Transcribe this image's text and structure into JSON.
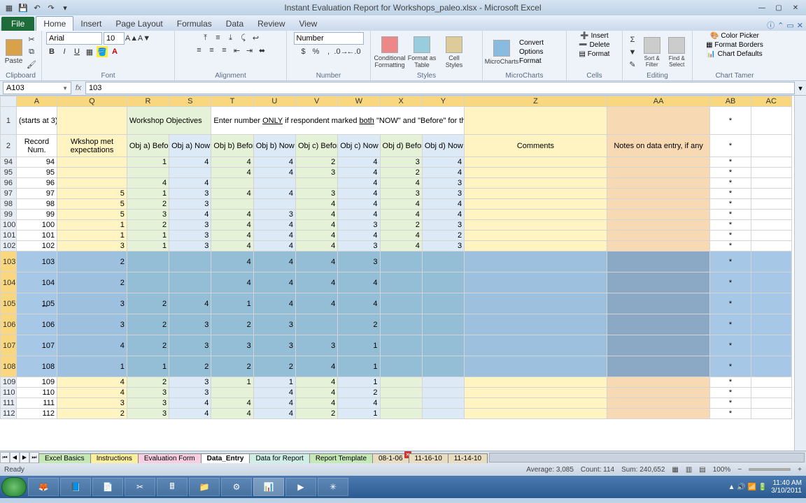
{
  "window": {
    "title": "Instant Evaluation Report for Workshops_paleo.xlsx - Microsoft Excel"
  },
  "ribbon": {
    "file": "File",
    "tabs": [
      "Home",
      "Insert",
      "Page Layout",
      "Formulas",
      "Data",
      "Review",
      "View"
    ],
    "active_tab": "Home",
    "groups": {
      "clipboard": "Clipboard",
      "font": "Font",
      "alignment": "Alignment",
      "number": "Number",
      "styles": "Styles",
      "microcharts": "MicroCharts",
      "cells": "Cells",
      "editing": "Editing",
      "charttamer": "Chart Tamer"
    },
    "clipboard_paste": "Paste",
    "font_name": "Arial",
    "font_size": "10",
    "number_format": "Number",
    "styles_items": {
      "cond": "Conditional Formatting",
      "table": "Format as Table",
      "cell": "Cell Styles"
    },
    "micro": {
      "a": "MicroCharts",
      "b": "Convert",
      "c": "Options",
      "d": "Format"
    },
    "cells": {
      "ins": "Insert",
      "del": "Delete",
      "fmt": "Format"
    },
    "editing": {
      "sort": "Sort & Filter",
      "find": "Find & Select"
    },
    "tamer": {
      "pick": "Color Picker",
      "borders": "Format Borders",
      "defaults": "Chart Defaults"
    }
  },
  "formula": {
    "name_box": "A103",
    "value": "103"
  },
  "columns": [
    "A",
    "Q",
    "R",
    "S",
    "T",
    "U",
    "V",
    "W",
    "X",
    "Y",
    "Z",
    "AA",
    "AB",
    "AC"
  ],
  "row1": {
    "a": "(starts at 3)",
    "r": "Workshop Objectives",
    "t": "Enter number ONLY if respondent marked both \"NOW\" and \"Before\" for that objective",
    "ab": "*"
  },
  "row2": {
    "a": "Record Num.",
    "q": "Wkshop met expectations",
    "r": "Obj a) Before",
    "s": "Obj a) Now",
    "t": "Obj b) Before",
    "u": "Obj b) Now",
    "v": "Obj c) Before",
    "w": "Obj c) Now",
    "x": "Obj d) Before",
    "y": "Obj d) Now",
    "z": "Comments",
    "aa": "Notes on data entry, if any",
    "ab": "*"
  },
  "rows": [
    {
      "n": 94,
      "a": 94,
      "q": "",
      "r": 1,
      "s": 4,
      "t": 4,
      "u": 4,
      "v": 2,
      "w": 4,
      "x": 3,
      "y": 4
    },
    {
      "n": 95,
      "a": 95,
      "q": "",
      "r": "",
      "s": "",
      "t": 4,
      "u": 4,
      "v": 3,
      "w": 4,
      "x": 2,
      "y": 4
    },
    {
      "n": 96,
      "a": 96,
      "q": "",
      "r": 4,
      "s": 4,
      "t": "",
      "u": "",
      "v": "",
      "w": 4,
      "x": 4,
      "y": 3
    },
    {
      "n": 97,
      "a": 97,
      "q": 5,
      "r": 1,
      "s": 3,
      "t": 4,
      "u": 4,
      "v": 3,
      "w": 4,
      "x": 3,
      "y": 3
    },
    {
      "n": 98,
      "a": 98,
      "q": 5,
      "r": 2,
      "s": 3,
      "t": "",
      "u": "",
      "v": 4,
      "w": 4,
      "x": 4,
      "y": 4
    },
    {
      "n": 99,
      "a": 99,
      "q": 5,
      "r": 3,
      "s": 4,
      "t": 4,
      "u": 3,
      "v": 4,
      "w": 4,
      "x": 4,
      "y": 4
    },
    {
      "n": 100,
      "a": 100,
      "q": 1,
      "r": 2,
      "s": 3,
      "t": 4,
      "u": 4,
      "v": 4,
      "w": 3,
      "x": 2,
      "y": 3
    },
    {
      "n": 101,
      "a": 101,
      "q": 1,
      "r": 1,
      "s": 3,
      "t": 4,
      "u": 4,
      "v": 4,
      "w": 4,
      "x": 4,
      "y": 2
    },
    {
      "n": 102,
      "a": 102,
      "q": 3,
      "r": 1,
      "s": 3,
      "t": 4,
      "u": 4,
      "v": 4,
      "w": 3,
      "x": 4,
      "y": 3
    },
    {
      "n": 103,
      "a": 103,
      "q": 2,
      "r": "",
      "s": "",
      "t": 4,
      "u": 4,
      "v": 4,
      "w": 3,
      "x": "",
      "y": ""
    },
    {
      "n": 104,
      "a": 104,
      "q": 2,
      "r": "",
      "s": "",
      "t": 4,
      "u": 4,
      "v": 4,
      "w": 4,
      "x": "",
      "y": ""
    },
    {
      "n": 105,
      "a": 105,
      "q": 3,
      "r": 2,
      "s": 4,
      "t": 1,
      "u": 4,
      "v": 4,
      "w": 4,
      "x": "",
      "y": ""
    },
    {
      "n": 106,
      "a": 106,
      "q": 3,
      "r": 2,
      "s": 3,
      "t": 2,
      "u": 3,
      "v": "",
      "w": 2,
      "x": "",
      "y": ""
    },
    {
      "n": 107,
      "a": 107,
      "q": 4,
      "r": 2,
      "s": 3,
      "t": 3,
      "u": 3,
      "v": 3,
      "w": 1,
      "x": "",
      "y": ""
    },
    {
      "n": 108,
      "a": 108,
      "q": 1,
      "r": 1,
      "s": 2,
      "t": 2,
      "u": 2,
      "v": 4,
      "w": 1,
      "x": "",
      "y": ""
    },
    {
      "n": 109,
      "a": 109,
      "q": 4,
      "r": 2,
      "s": 3,
      "t": 1,
      "u": 1,
      "v": 4,
      "w": 1,
      "x": "",
      "y": ""
    },
    {
      "n": 110,
      "a": 110,
      "q": 4,
      "r": 3,
      "s": 3,
      "t": "",
      "u": 4,
      "v": 4,
      "w": 2,
      "x": "",
      "y": ""
    },
    {
      "n": 111,
      "a": 111,
      "q": 3,
      "r": 3,
      "s": 4,
      "t": 4,
      "u": 4,
      "v": 4,
      "w": 4,
      "x": "",
      "y": ""
    },
    {
      "n": 112,
      "a": 112,
      "q": 2,
      "r": 3,
      "s": 4,
      "t": 4,
      "u": 4,
      "v": 2,
      "w": 1,
      "x": "",
      "y": ""
    }
  ],
  "selected_rows": [
    103,
    104,
    105,
    106,
    107,
    108
  ],
  "sheet_tabs": [
    {
      "label": "Excel Basics",
      "cls": "t-green"
    },
    {
      "label": "Instructions",
      "cls": "t-yellow"
    },
    {
      "label": "Evaluation Form",
      "cls": "t-pink"
    },
    {
      "label": "Data_Entry",
      "cls": "t-white"
    },
    {
      "label": "Data for Report",
      "cls": "t-teal"
    },
    {
      "label": "Report Template",
      "cls": "t-green"
    },
    {
      "label": "08-1-06",
      "cls": "t-tan",
      "x": true
    },
    {
      "label": "11-16-10",
      "cls": "t-tan"
    },
    {
      "label": "11-14-10",
      "cls": "t-tan"
    }
  ],
  "status": {
    "ready": "Ready",
    "avg": "Average: 3,085",
    "count": "Count: 114",
    "sum": "Sum: 240,652",
    "zoom": "100%"
  },
  "tray": {
    "time": "11:40 AM",
    "date": "3/10/2011"
  }
}
